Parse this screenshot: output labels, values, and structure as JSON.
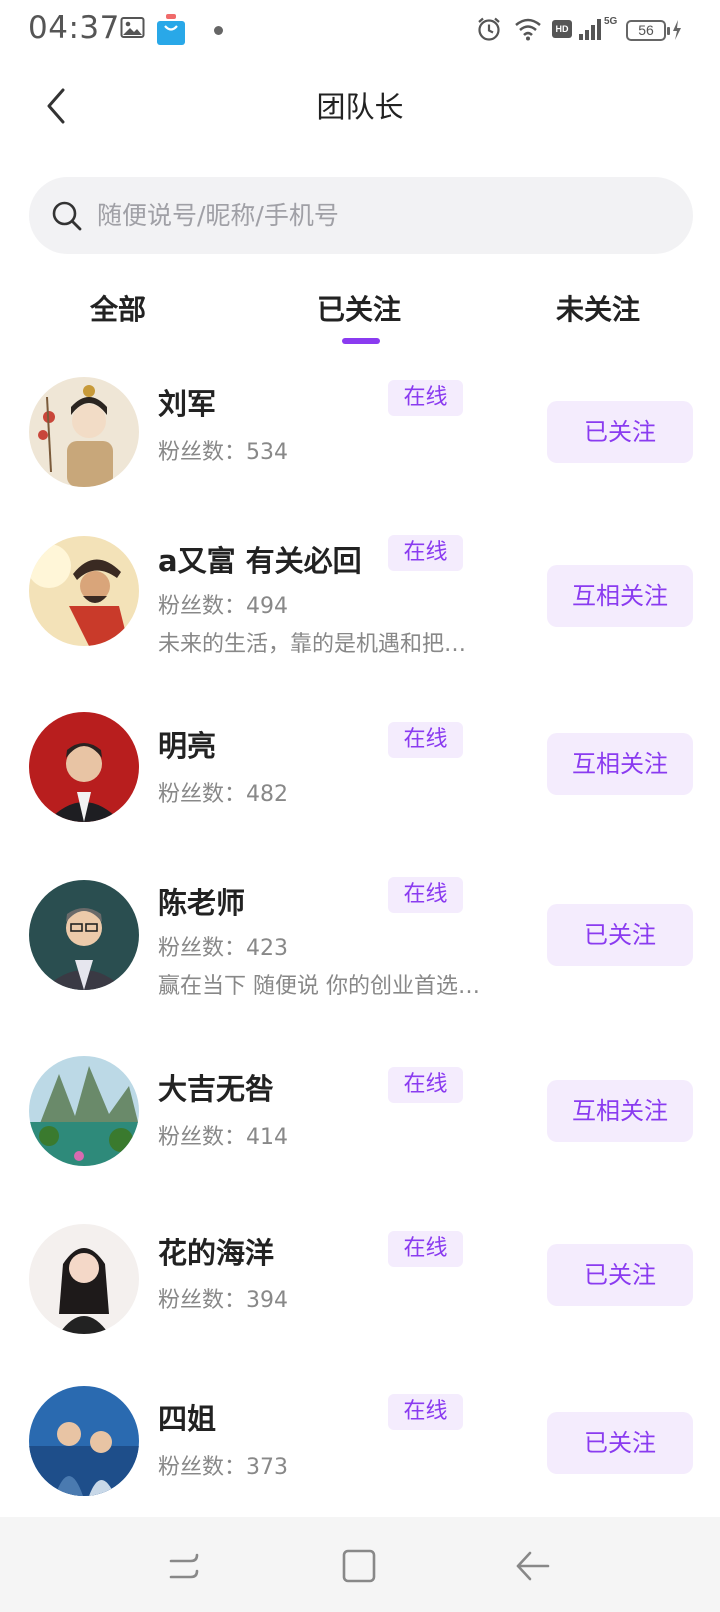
{
  "status_bar": {
    "time": "04:37",
    "battery": "56",
    "hd": "HD",
    "network": "5G",
    "icons": [
      "gallery-icon",
      "shopping-bag-icon",
      "notification-dot-icon",
      "alarm-icon",
      "wifi-icon",
      "hd-icon",
      "signal-icon",
      "battery-icon",
      "charging-icon"
    ]
  },
  "header": {
    "title": "团队长",
    "back_icon": "chevron-left-icon"
  },
  "search": {
    "placeholder": "随便说号/昵称/手机号",
    "value": "",
    "icon": "search-icon"
  },
  "tabs": [
    {
      "label": "全部",
      "active": false
    },
    {
      "label": "已关注",
      "active": true
    },
    {
      "label": "未关注",
      "active": false
    }
  ],
  "colors": {
    "accent": "#8a3bf0",
    "badge_bg": "#f4ecfd",
    "search_bg": "#f2f2f4",
    "nav_bg": "#f5f5f5"
  },
  "users": [
    {
      "name": "刘军",
      "status": "在线",
      "fans": "粉丝数：534",
      "bio": "",
      "follow": "已关注"
    },
    {
      "name": "a又富 有关必回",
      "status": "在线",
      "fans": "粉丝数：494",
      "bio": "未来的生活，靠的是机遇和把…",
      "follow": "互相关注"
    },
    {
      "name": "明亮",
      "status": "在线",
      "fans": "粉丝数：482",
      "bio": "",
      "follow": "互相关注"
    },
    {
      "name": "陈老师",
      "status": "在线",
      "fans": "粉丝数：423",
      "bio": "赢在当下 随便说 你的创业首选…",
      "follow": "已关注"
    },
    {
      "name": "大吉无咎",
      "status": "在线",
      "fans": "粉丝数：414",
      "bio": "",
      "follow": "互相关注"
    },
    {
      "name": "花的海洋",
      "status": "在线",
      "fans": "粉丝数：394",
      "bio": "",
      "follow": "已关注"
    },
    {
      "name": "四姐",
      "status": "在线",
      "fans": "粉丝数：373",
      "bio": "",
      "follow": "已关注"
    }
  ],
  "nav": {
    "icons": [
      "recent-apps-icon",
      "home-icon",
      "back-icon"
    ]
  }
}
